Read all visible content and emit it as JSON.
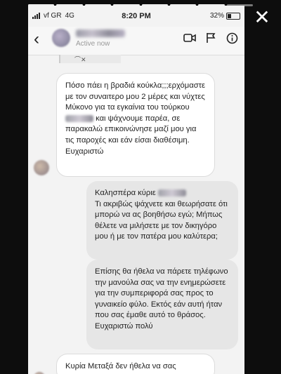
{
  "close_icon": "close-icon",
  "status": {
    "carrier": "vf GR",
    "network": "4G",
    "time": "8:20 PM",
    "battery": "32%"
  },
  "header": {
    "contact_name": "",
    "activity": "Active now",
    "icons": [
      "back-icon",
      "video-call-icon",
      "flag-icon",
      "info-icon"
    ]
  },
  "messages": [
    {
      "side": "incoming",
      "text": "Πόσο πάει η βραδιά κούκλα;;;ερχόμαστε με τον συναιτερο μου 2 μέρες και νύχτες Μύκονο για τα εγκαίνια του τούρκου",
      "text_tail": "και ψάχνουμε παρέα, σε παρακαλώ επικοινώνησε μαζί μου για τις παροχές και εάν είσαι διαθέσιμη. Ευχαριστώ"
    },
    {
      "side": "outgoing",
      "text": "Καλησπέρα κύριε",
      "text_tail": "Τι ακριβώς ψάχνετε και θεωρήσατε ότι μπορώ να ας βοηθήσω εγώ; Μήπως θέλετε να μιλήσετε με τον δικηγόρο μου ή με τον πατέρα μου καλύτερα;"
    },
    {
      "side": "outgoing",
      "text": "Επίσης θα ήθελα να πάρετε τηλέφωνο την μανούλα σας να την ενημερώσετε για την συμπεριφορά σας προς το γυναικείο φύλο. Εκτός εάν αυτή ήταν που σας έμαθε αυτό το θράσος.\nΕυχαριστώ πολύ"
    },
    {
      "side": "incoming",
      "text": "Κυρία Μεταξά δεν ήθελα να σας"
    }
  ]
}
